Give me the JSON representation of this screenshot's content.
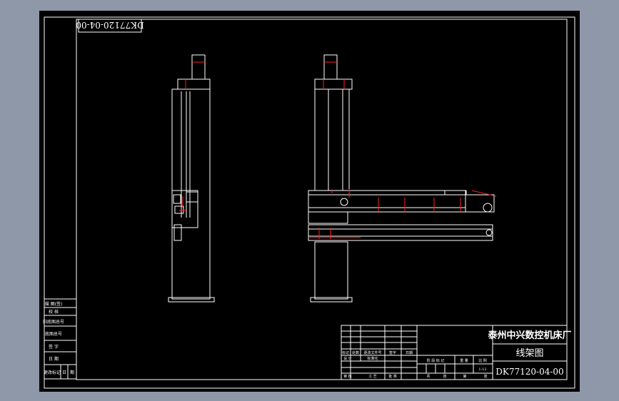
{
  "drawing": {
    "top_code": "DK77120-04-00",
    "company": "泰州中兴数控机床厂",
    "title": "线架图",
    "code": "DK77120-04-00"
  },
  "left_block": {
    "rows": [
      "描 图(签)",
      "校 核",
      "旧底图总号",
      "底图总号",
      "签 字",
      "日 期"
    ],
    "footer": [
      "更改标记",
      "日",
      "期"
    ]
  },
  "title_block": {
    "labels": {
      "mark": "标记",
      "count": "处数",
      "doc": "更改文件号",
      "sign": "签字",
      "date": "日期",
      "design": "设 计",
      "std": "标准化",
      "stage": "阶 段 标 记",
      "weight": "重 量",
      "scale": "比 例",
      "ratio": "1:12",
      "check": "审 核",
      "process": "工 艺",
      "approve": "批 准",
      "sheet": "共",
      "sheet2": "张",
      "page": "第",
      "page2": "张"
    }
  },
  "colors": {
    "background": "#000000",
    "outer": "#8f98a8",
    "line": "#ffffff",
    "dimension": "#ff2020"
  }
}
